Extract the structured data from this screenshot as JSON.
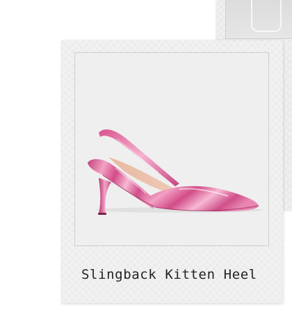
{
  "product_card": {
    "caption": "Slingback Kitten Heel"
  },
  "colors": {
    "card_background": "#f1f1f1",
    "photo_background": "#efefef",
    "shoe_pink": "#e0609a",
    "caption_text": "#222222"
  },
  "icons": {
    "product_image": "pink-metallic-slingback-shoe"
  }
}
